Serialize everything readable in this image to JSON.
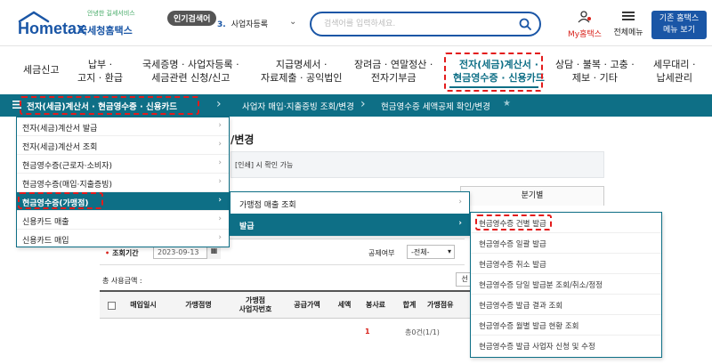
{
  "header": {
    "logo_text": "Hometax",
    "logo_tagline": "안녕한 길세서비스",
    "logo_sub": "국세청홈택스",
    "popular_badge": "인기검색어",
    "popular_rank": "3.",
    "popular_term": "사업자등록",
    "search_placeholder": "검색어를 입력하세요.",
    "my_hometax": "My홈택스",
    "all_menu": "전체메뉴",
    "classic_line1": "기존 홈택스",
    "classic_line2": "메뉴 보기"
  },
  "main_nav": {
    "items": [
      {
        "line1": "세금신고",
        "line2": ""
      },
      {
        "line1": "납부 ·",
        "line2": "고지 · 환급"
      },
      {
        "line1": "국세증명 · 사업자등록 ·",
        "line2": "세금관련 신청/신고"
      },
      {
        "line1": "지급명세서 ·",
        "line2": "자료제출 · 공익법인"
      },
      {
        "line1": "장려금 · 연말정산 ·",
        "line2": "전자기부금"
      },
      {
        "line1": "전자(세금)계산서 ·",
        "line2": "현금영수증 · 신용카드"
      },
      {
        "line1": "상담 · 불복 · 고충 ·",
        "line2": "제보 · 기타"
      },
      {
        "line1": "세무대리 ·",
        "line2": "납세관리"
      }
    ]
  },
  "breadcrumb": {
    "level1": "전자(세금)계산서 · 현금영수증 · 신용카드",
    "level2": "사업자 매입·지출증빙 조회/변경",
    "level3": "현금영수증 세액공제 확인/변경"
  },
  "dropdown_level1": {
    "items": [
      "전자(세금)계산서 발급",
      "전자(세금)계산서 조회",
      "현금영수증(근로자·소비자)",
      "현금영수증(매입·지출증빙)",
      "현금영수증(가맹점)",
      "신용카드 매출",
      "신용카드 매입"
    ],
    "selected_index": 4
  },
  "dropdown_level2": {
    "items": [
      "가맹점 매출 조회",
      "발급"
    ],
    "selected_index": 1
  },
  "dropdown_level3": {
    "items": [
      "현금영수증 건별 발급",
      "현금영수증 일괄 발급",
      "현금영수증 취소 발급",
      "현금영수증 당일 발급분 조회/취소/정정",
      "현금영수증 발급 결과 조회",
      "현금영수증 월별 발급 현황 조회",
      "현금영수증 발급 사업자 신청 및 수정"
    ]
  },
  "page": {
    "title": "/변경",
    "notice": "[인쇄] 시 확인 가능",
    "tab_right": "분기별",
    "period_label": "조회기간",
    "period_value": "2023-09-13",
    "deduct_label": "공제여부",
    "deduct_value": "-전체-",
    "total_label": "총 사용금액 :",
    "top_button": "선",
    "table_headers": [
      "매입일시",
      "가맹점명",
      "가맹점\n사업자번호",
      "공급가액",
      "세액",
      "봉사료",
      "합계",
      "가맹점유"
    ],
    "pager_current": "1",
    "pager_total": "총0건(1/1)"
  },
  "colors": {
    "brand_blue": "#1a56a6",
    "teal": "#0e6f86",
    "highlight_red": "#e31b1b"
  }
}
